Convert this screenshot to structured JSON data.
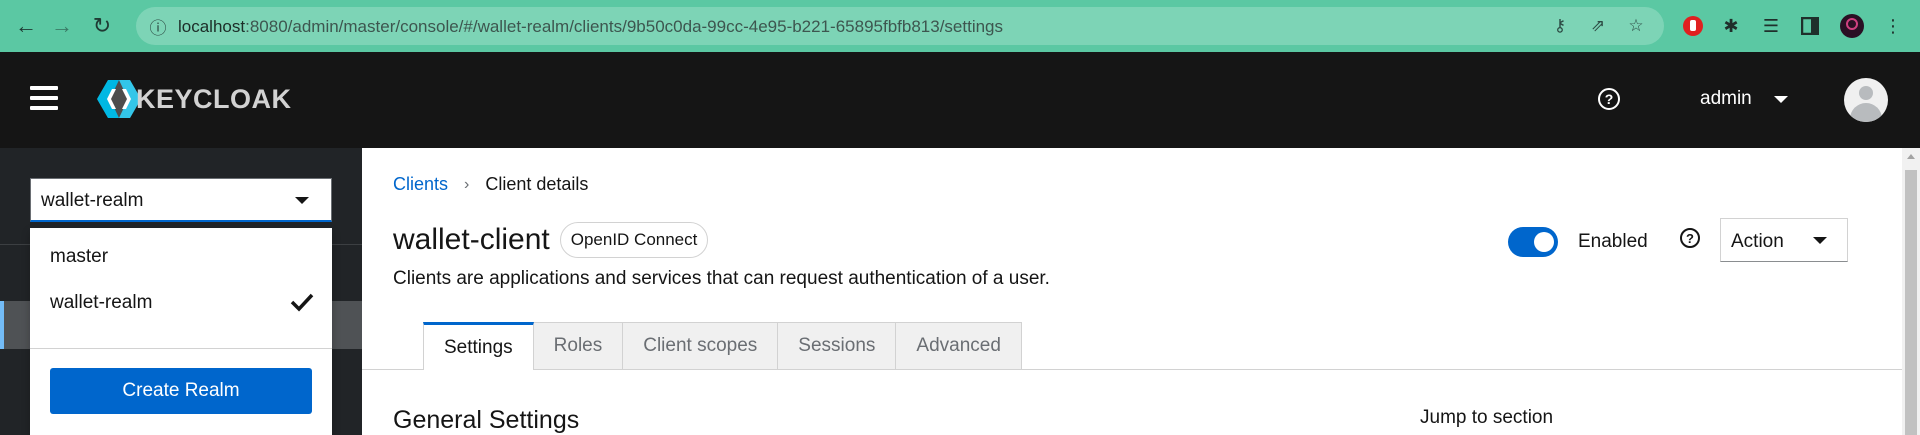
{
  "browser": {
    "url_host": "localhost",
    "url_path": ":8080/admin/master/console/#/wallet-realm/clients/9b50c0da-99cc-4e95-b221-65895fbfb813/settings"
  },
  "header": {
    "logo_text": "KEYCLOAK",
    "user_name": "admin"
  },
  "realm_selector": {
    "selected": "wallet-realm",
    "options": [
      {
        "label": "master",
        "selected": false
      },
      {
        "label": "wallet-realm",
        "selected": true
      }
    ],
    "create_label": "Create Realm"
  },
  "breadcrumb": {
    "link": "Clients",
    "current": "Client details"
  },
  "client": {
    "title": "wallet-client",
    "protocol_badge": "OpenID Connect",
    "description": "Clients are applications and services that can request authentication of a user.",
    "enabled_label": "Enabled",
    "enabled": true,
    "action_label": "Action"
  },
  "tabs": [
    {
      "label": "Settings",
      "active": true
    },
    {
      "label": "Roles",
      "active": false
    },
    {
      "label": "Client scopes",
      "active": false
    },
    {
      "label": "Sessions",
      "active": false
    },
    {
      "label": "Advanced",
      "active": false
    }
  ],
  "content": {
    "section_title": "General Settings",
    "jump_label": "Jump to section"
  },
  "colors": {
    "browser_accent": "#5bc8a3",
    "header_bg": "#151515",
    "sidebar_bg": "#212427",
    "primary": "#0066cc"
  }
}
